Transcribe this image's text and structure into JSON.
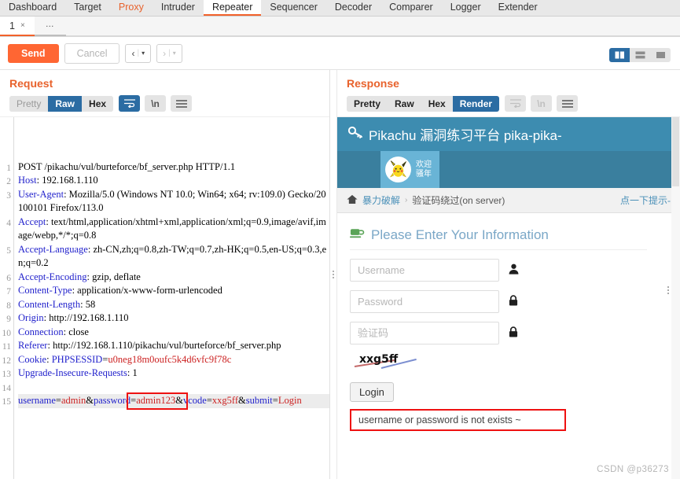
{
  "main_tabs": [
    {
      "label": "Dashboard",
      "state": "normal"
    },
    {
      "label": "Target",
      "state": "normal"
    },
    {
      "label": "Proxy",
      "state": "accent"
    },
    {
      "label": "Intruder",
      "state": "normal"
    },
    {
      "label": "Repeater",
      "state": "active"
    },
    {
      "label": "Sequencer",
      "state": "normal"
    },
    {
      "label": "Decoder",
      "state": "normal"
    },
    {
      "label": "Comparer",
      "state": "normal"
    },
    {
      "label": "Logger",
      "state": "normal"
    },
    {
      "label": "Extender",
      "state": "normal"
    }
  ],
  "repeater_tabs": {
    "active_label": "1",
    "close_glyph": "×",
    "more_label": "…"
  },
  "toolbar": {
    "send_label": "Send",
    "cancel_label": "Cancel",
    "prev_glyph": "‹",
    "next_glyph": "›",
    "caret_glyph": "▾",
    "divider_glyph": "|"
  },
  "layout_switch": {
    "options": [
      "side-by-side",
      "stacked",
      "single"
    ],
    "selected": "side-by-side"
  },
  "request": {
    "title": "Request",
    "view_tabs": [
      {
        "label": "Pretty",
        "active": false,
        "muted": true
      },
      {
        "label": "Raw",
        "active": true,
        "muted": false
      },
      {
        "label": "Hex",
        "active": false,
        "muted": false
      }
    ],
    "wrap_icon": "wrap-lines-icon",
    "wrap_active": true,
    "newline_label": "\\n",
    "menu_icon": "hamburger-icon",
    "lines": [
      {
        "n": "1",
        "segments": [
          {
            "t": "POST /pikachu/vul/burteforce/bf_server.php HTTP/1.1",
            "c": "plain"
          }
        ]
      },
      {
        "n": "2",
        "segments": [
          {
            "t": "Host",
            "c": "key"
          },
          {
            "t": ": 192.168.1.110",
            "c": "plain"
          }
        ]
      },
      {
        "n": "3",
        "segments": [
          {
            "t": "User-Agent",
            "c": "key"
          },
          {
            "t": ": Mozilla/5.0 (Windows NT 10.0; Win64; x64; rv:109.0) Gecko/20100101 Firefox/113.0",
            "c": "plain"
          }
        ]
      },
      {
        "n": "4",
        "segments": [
          {
            "t": "Accept",
            "c": "key"
          },
          {
            "t": ": text/html,application/xhtml+xml,application/xml;q=0.9,image/avif,image/webp,*/*;q=0.8",
            "c": "plain"
          }
        ]
      },
      {
        "n": "5",
        "segments": [
          {
            "t": "Accept-Language",
            "c": "key"
          },
          {
            "t": ": zh-CN,zh;q=0.8,zh-TW;q=0.7,zh-HK;q=0.5,en-US;q=0.3,en;q=0.2",
            "c": "plain"
          }
        ]
      },
      {
        "n": "6",
        "segments": [
          {
            "t": "Accept-Encoding",
            "c": "key"
          },
          {
            "t": ": gzip, deflate",
            "c": "plain"
          }
        ]
      },
      {
        "n": "7",
        "segments": [
          {
            "t": "Content-Type",
            "c": "key"
          },
          {
            "t": ": application/x-www-form-urlencoded",
            "c": "plain"
          }
        ]
      },
      {
        "n": "8",
        "segments": [
          {
            "t": "Content-Length",
            "c": "key"
          },
          {
            "t": ": 58",
            "c": "plain"
          }
        ]
      },
      {
        "n": "9",
        "segments": [
          {
            "t": "Origin",
            "c": "key"
          },
          {
            "t": ": http://192.168.1.110",
            "c": "plain"
          }
        ]
      },
      {
        "n": "10",
        "segments": [
          {
            "t": "Connection",
            "c": "key"
          },
          {
            "t": ": close",
            "c": "plain"
          }
        ]
      },
      {
        "n": "11",
        "segments": [
          {
            "t": "Referer",
            "c": "key"
          },
          {
            "t": ": http://192.168.1.110/pikachu/vul/burteforce/bf_server.php",
            "c": "plain"
          }
        ]
      },
      {
        "n": "12",
        "segments": [
          {
            "t": "Cookie",
            "c": "key"
          },
          {
            "t": ": ",
            "c": "plain"
          },
          {
            "t": "PHPSESSID",
            "c": "key"
          },
          {
            "t": "=",
            "c": "plain"
          },
          {
            "t": "u0neg18m0oufc5k4d6vfc9f78c",
            "c": "red"
          }
        ]
      },
      {
        "n": "13",
        "segments": [
          {
            "t": "Upgrade-Insecure-Requests",
            "c": "key"
          },
          {
            "t": ": 1",
            "c": "plain"
          }
        ]
      },
      {
        "n": "14",
        "segments": [
          {
            "t": "",
            "c": "plain"
          }
        ]
      },
      {
        "n": "15",
        "segments": [
          {
            "t": "username",
            "c": "key"
          },
          {
            "t": "=",
            "c": "plain"
          },
          {
            "t": "admin",
            "c": "red"
          },
          {
            "t": "&",
            "c": "plain"
          },
          {
            "t": "password",
            "c": "key"
          },
          {
            "t": "=",
            "c": "plain"
          },
          {
            "t": "admin123",
            "c": "red"
          },
          {
            "t": "&",
            "c": "plain"
          },
          {
            "t": "vcode",
            "c": "key"
          },
          {
            "t": "=",
            "c": "plain"
          },
          {
            "t": "xxg5ff",
            "c": "red"
          },
          {
            "t": "&",
            "c": "plain"
          },
          {
            "t": "submit",
            "c": "key"
          },
          {
            "t": "=",
            "c": "plain"
          },
          {
            "t": "Login",
            "c": "red"
          }
        ]
      }
    ]
  },
  "response": {
    "title": "Response",
    "view_tabs": [
      {
        "label": "Pretty",
        "active": false,
        "muted": false
      },
      {
        "label": "Raw",
        "active": false,
        "muted": false
      },
      {
        "label": "Hex",
        "active": false,
        "muted": false
      },
      {
        "label": "Render",
        "active": true,
        "muted": false
      }
    ],
    "wrap_icon": "wrap-lines-icon",
    "newline_label": "\\n",
    "menu_icon": "hamburger-icon",
    "rendered_page": {
      "site_header": "Pikachu 漏洞练习平台 pika-pika-",
      "site_header_icon": "key-icon",
      "avatar_icon": "pikachu-avatar",
      "welcome_line1": "欢迎",
      "welcome_line2": "骚年",
      "breadcrumb": {
        "home_icon": "home-icon",
        "parent": "暴力破解",
        "separator": "›",
        "current": "验证码绕过(on server)",
        "hint": "点一下提示-"
      },
      "form_title": "Please Enter Your Information",
      "form_title_icon": "coffee-cup-icon",
      "fields": [
        {
          "placeholder": "Username",
          "value": "",
          "icon": "user-icon"
        },
        {
          "placeholder": "Password",
          "value": "",
          "icon": "lock-icon"
        },
        {
          "placeholder": "验证码",
          "value": "",
          "icon": "lock-icon"
        }
      ],
      "captcha_text": "xxg5ff",
      "submit_label": "Login",
      "error_message": "username or password is not exists ~",
      "watermark": "CSDN @p36273"
    }
  },
  "colors": {
    "accent_orange": "#ff6633",
    "title_orange": "#e8622c",
    "accent_blue": "#2b6ca3",
    "error_red": "#ee1111",
    "pikachu_header": "#3d8cb0",
    "pikachu_subbar": "#3a7f9e",
    "pikachu_userbox": "#69b4d6"
  }
}
